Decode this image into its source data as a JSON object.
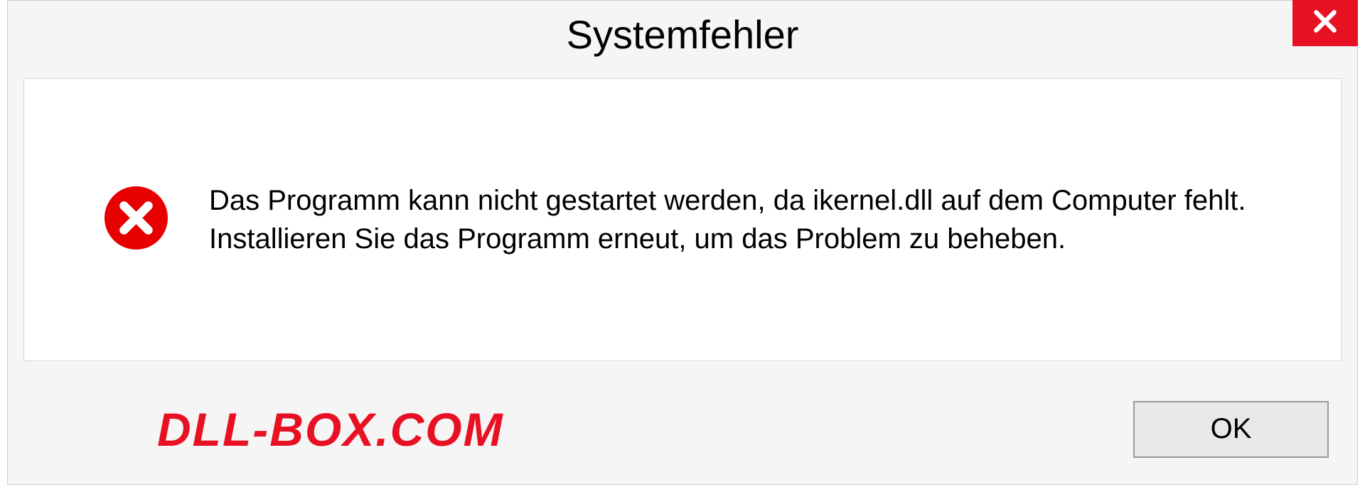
{
  "dialog": {
    "title": "Systemfehler",
    "message": "Das Programm kann nicht gestartet werden, da ikernel.dll auf dem Computer fehlt. Installieren Sie das Programm erneut, um das Problem zu beheben.",
    "ok_label": "OK"
  },
  "watermark": "DLL-BOX.COM"
}
